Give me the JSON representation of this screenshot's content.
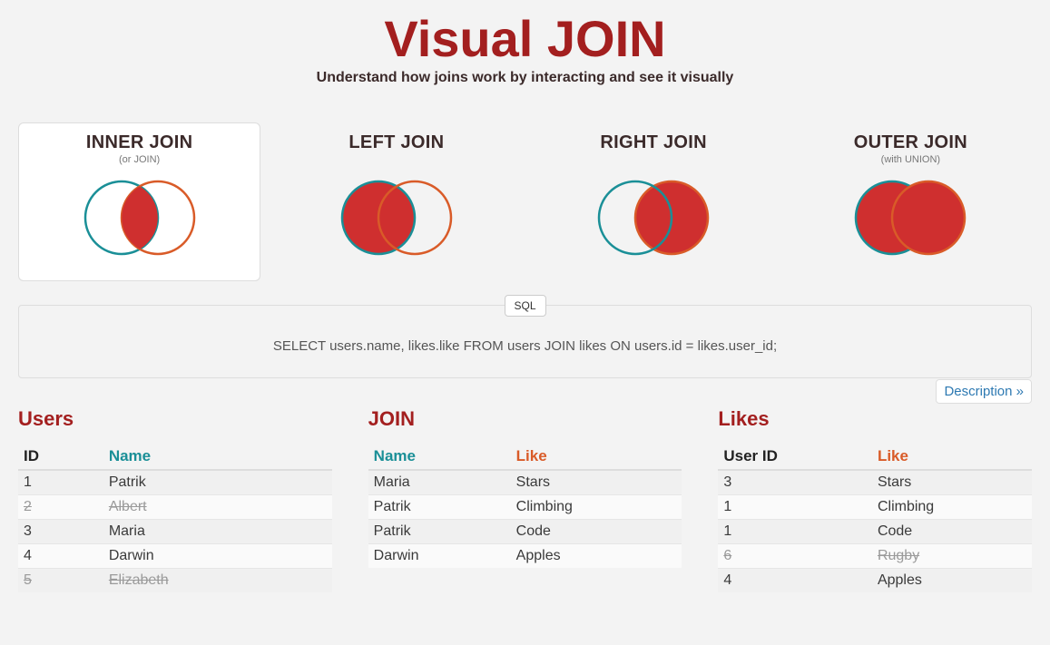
{
  "header": {
    "title": "Visual JOIN",
    "subtitle": "Understand how joins work by interacting and see it visually"
  },
  "joins": [
    {
      "label": "INNER JOIN",
      "note": "(or JOIN)",
      "kind": "inner",
      "active": true
    },
    {
      "label": "LEFT JOIN",
      "note": "",
      "kind": "left",
      "active": false
    },
    {
      "label": "RIGHT JOIN",
      "note": "",
      "kind": "right",
      "active": false
    },
    {
      "label": "OUTER JOIN",
      "note": "(with UNION)",
      "kind": "outer",
      "active": false
    }
  ],
  "sql": {
    "badge": "SQL",
    "query": "SELECT users.name, likes.like FROM users JOIN likes ON users.id = likes.user_id;"
  },
  "description_link": "Description »",
  "tables": {
    "users": {
      "title": "Users",
      "headers": {
        "id": "ID",
        "name": "Name"
      },
      "rows": [
        {
          "id": "1",
          "name": "Patrik",
          "excluded": false
        },
        {
          "id": "2",
          "name": "Albert",
          "excluded": true
        },
        {
          "id": "3",
          "name": "Maria",
          "excluded": false
        },
        {
          "id": "4",
          "name": "Darwin",
          "excluded": false
        },
        {
          "id": "5",
          "name": "Elizabeth",
          "excluded": true
        }
      ]
    },
    "join": {
      "title": "JOIN",
      "headers": {
        "name": "Name",
        "like": "Like"
      },
      "rows": [
        {
          "name": "Maria",
          "like": "Stars"
        },
        {
          "name": "Patrik",
          "like": "Climbing"
        },
        {
          "name": "Patrik",
          "like": "Code"
        },
        {
          "name": "Darwin",
          "like": "Apples"
        }
      ]
    },
    "likes": {
      "title": "Likes",
      "headers": {
        "user_id": "User ID",
        "like": "Like"
      },
      "rows": [
        {
          "user_id": "3",
          "like": "Stars",
          "excluded": false
        },
        {
          "user_id": "1",
          "like": "Climbing",
          "excluded": false
        },
        {
          "user_id": "1",
          "like": "Code",
          "excluded": false
        },
        {
          "user_id": "6",
          "like": "Rugby",
          "excluded": true
        },
        {
          "user_id": "4",
          "like": "Apples",
          "excluded": false
        }
      ]
    }
  },
  "colors": {
    "brand": "#a31f1f",
    "teal": "#1a8f97",
    "orange": "#d95b28",
    "fill": "#cf2f2f"
  }
}
